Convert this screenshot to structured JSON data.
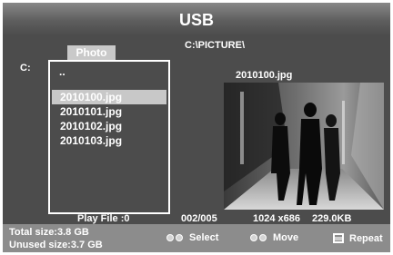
{
  "title": "USB",
  "tab": "Photo",
  "path": "C:\\PICTURE\\",
  "drive": "C:",
  "parent_dir": "..",
  "files": [
    "2010100.jpg",
    "2010101.jpg",
    "2010102.jpg",
    "2010103.jpg"
  ],
  "selected_index": 0,
  "preview": {
    "filename": "2010100.jpg"
  },
  "status": {
    "play_file": "Play File  :0",
    "index": "002/005",
    "resolution": "1024 x686",
    "size": "229.0KB"
  },
  "footer": {
    "total_size": "Total size:3.8  GB",
    "unused_size": "Unused size:3.7  GB",
    "select_label": "Select",
    "move_label": "Move",
    "repeat_label": "Repeat"
  }
}
